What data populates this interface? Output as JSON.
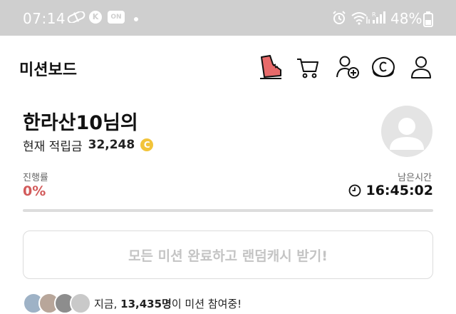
{
  "status_bar": {
    "time": "07:14",
    "kakao_letter": "K",
    "on_badge": "ON",
    "battery": "48%",
    "bg_color": "#cfcfcf"
  },
  "header": {
    "title": "미션보드",
    "icons": [
      "mission-shoe-icon",
      "cart-icon",
      "add-friend-icon",
      "coin-icon",
      "profile-icon"
    ]
  },
  "user": {
    "greeting": "한라산10님의",
    "points_label": "현재 적립금",
    "points_value": "32,248",
    "coin_symbol": "C"
  },
  "progress": {
    "label": "진행률",
    "value": "0%",
    "fraction": 0,
    "color": "#d25a5a"
  },
  "timer": {
    "label": "남은시간",
    "value": "16:45:02"
  },
  "reward_button": {
    "label": "모든 미션 완료하고 랜덤캐시 받기!"
  },
  "participants": {
    "prefix": "지금,",
    "count": "13,435명",
    "suffix": "이 미션 참여중!"
  }
}
